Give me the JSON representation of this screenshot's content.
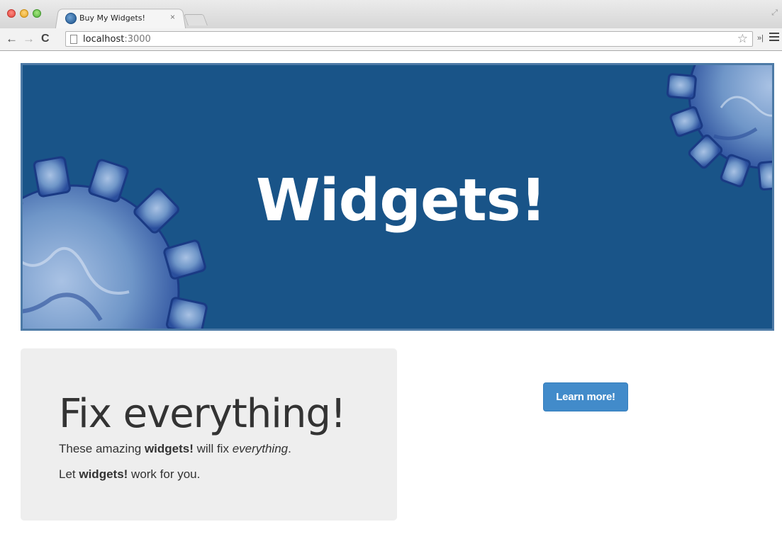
{
  "browser": {
    "tab_title": "Buy My Widgets!",
    "tab_close": "×",
    "url_host": "localhost",
    "url_port": ":3000"
  },
  "hero": {
    "title": "Widgets!"
  },
  "well": {
    "headline": "Fix everything!",
    "p1_before": "These amazing ",
    "p1_bold": "widgets!",
    "p1_middle": " will fix ",
    "p1_italic": "everything",
    "p1_after": ".",
    "p2_before": "Let ",
    "p2_bold": "widgets!",
    "p2_after": " work for you."
  },
  "cta": {
    "label": "Learn more!",
    "color": "#428bca"
  },
  "colors": {
    "hero_background": "#195488",
    "gear_light": "#7ea3cf",
    "gear_dark": "#1d3f8a"
  }
}
